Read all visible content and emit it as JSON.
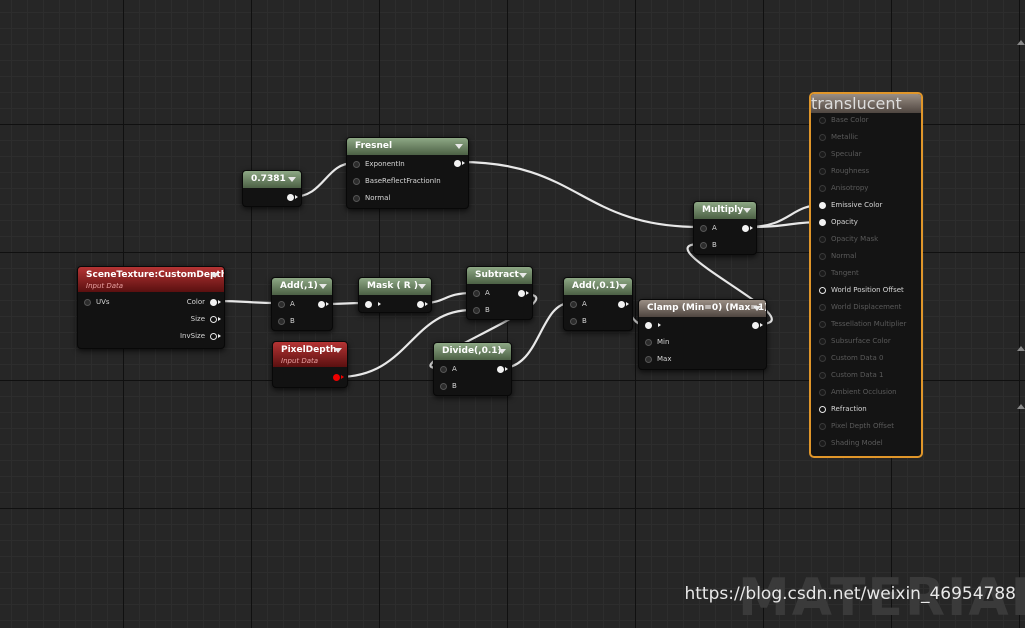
{
  "nodes": {
    "const": {
      "value": "0.7381"
    },
    "fresnel": {
      "title": "Fresnel",
      "pins": [
        "ExponentIn",
        "BaseReflectFractionIn",
        "Normal"
      ]
    },
    "scene_texture": {
      "title": "SceneTexture:CustomDepth",
      "subtitle": "Input Data",
      "in_pin": "UVs",
      "out_pins": [
        "Color",
        "Size",
        "InvSize"
      ]
    },
    "add1": {
      "title": "Add(,1)",
      "pin_a": "A",
      "pin_b": "B"
    },
    "mask": {
      "title": "Mask ( R )"
    },
    "subtract": {
      "title": "Subtract",
      "pin_a": "A",
      "pin_b": "B"
    },
    "pixel_depth": {
      "title": "PixelDepth",
      "subtitle": "Input Data"
    },
    "divide": {
      "title": "Divide(,0.1)",
      "pin_a": "A",
      "pin_b": "B"
    },
    "add01": {
      "title": "Add(,0.1)",
      "pin_a": "A",
      "pin_b": "B"
    },
    "clamp": {
      "title": "Clamp (Min=0) (Max=1)",
      "pin_min": "Min",
      "pin_max": "Max"
    },
    "multiply": {
      "title": "Multiply",
      "pin_a": "A",
      "pin_b": "B"
    }
  },
  "material": {
    "title": "translucent",
    "inputs": [
      {
        "label": "Base Color",
        "active": false
      },
      {
        "label": "Metallic",
        "active": false
      },
      {
        "label": "Specular",
        "active": false
      },
      {
        "label": "Roughness",
        "active": false
      },
      {
        "label": "Anisotropy",
        "active": false
      },
      {
        "label": "Emissive Color",
        "active": true
      },
      {
        "label": "Opacity",
        "active": true
      },
      {
        "label": "Opacity Mask",
        "active": false
      },
      {
        "label": "Normal",
        "active": false
      },
      {
        "label": "Tangent",
        "active": false
      },
      {
        "label": "World Position Offset",
        "active": true
      },
      {
        "label": "World Displacement",
        "active": false
      },
      {
        "label": "Tessellation Multiplier",
        "active": false
      },
      {
        "label": "Subsurface Color",
        "active": false
      },
      {
        "label": "Custom Data 0",
        "active": false
      },
      {
        "label": "Custom Data 1",
        "active": false
      },
      {
        "label": "Ambient Occlusion",
        "active": false
      },
      {
        "label": "Refraction",
        "active": true
      },
      {
        "label": "Pixel Depth Offset",
        "active": false
      },
      {
        "label": "Shading Model",
        "active": false
      }
    ]
  },
  "background_label": "MATERIAL",
  "watermark": "https://blog.csdn.net/weixin_46954788",
  "colors": {
    "accent": "#e0962a",
    "math_header": "#6b8862",
    "input_header": "#8e1f1f"
  }
}
